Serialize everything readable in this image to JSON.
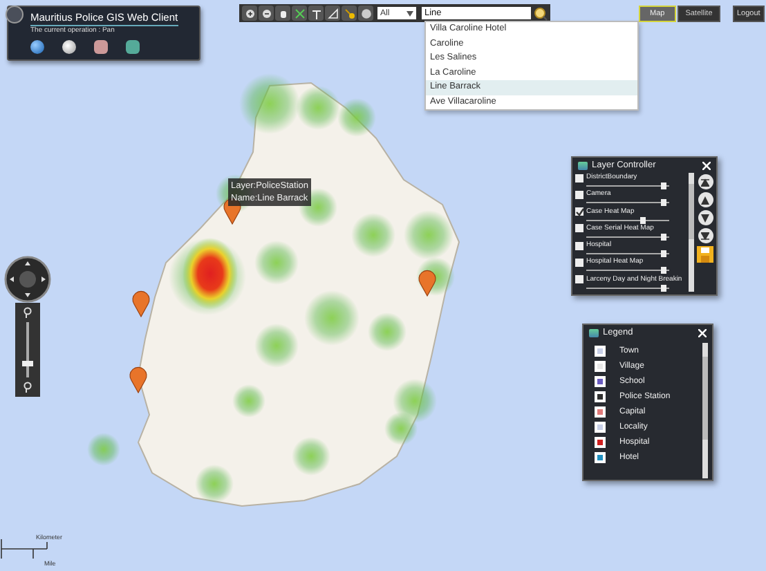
{
  "app_panel": {
    "title": "Mauritius Police GIS Web Client",
    "operation": "The current operation : Pan"
  },
  "toolbar": {
    "layer_select": "All",
    "search": {
      "value": "Line"
    },
    "suggestions": [
      {
        "label": "Villa Caroline Hotel",
        "selected": false
      },
      {
        "label": "Caroline",
        "selected": false
      },
      {
        "label": "Les Salines",
        "selected": false
      },
      {
        "label": "La Caroline",
        "selected": false
      },
      {
        "label": "Line Barrack",
        "selected": true
      },
      {
        "label": "Ave Villacaroline",
        "selected": false
      }
    ]
  },
  "map_types": [
    {
      "label": "Map",
      "selected": true
    },
    {
      "label": "Satellite",
      "selected": false
    }
  ],
  "logout": "Logout",
  "zoom_slider": {
    "level": 0.25
  },
  "map_tooltip": [
    "Layer:PoliceStation",
    "Name:Line Barrack"
  ],
  "layer_controller": {
    "title": "Layer Controller",
    "layers": [
      {
        "label": "DistrictBoundary",
        "checked": false,
        "level": 0.95
      },
      {
        "label": "Camera",
        "checked": false,
        "level": 0.95
      },
      {
        "label": "Case Heat Map",
        "checked": true,
        "level": 0.7
      },
      {
        "label": "Case Serial Heat Map",
        "checked": false,
        "level": 0.95
      },
      {
        "label": "Hospital",
        "checked": false,
        "level": 0.95
      },
      {
        "label": "Hospital Heat Map",
        "checked": false,
        "level": 0.95
      },
      {
        "label": "Larceny Day and Night Breakin",
        "checked": false,
        "level": 0.95
      }
    ]
  },
  "legend": {
    "title": "Legend",
    "items": [
      {
        "label": "Town",
        "color": "#c8d0e8"
      },
      {
        "label": "Village",
        "color": "#e8e8e8"
      },
      {
        "label": "School",
        "color": "#6a5cc0"
      },
      {
        "label": "Police Station",
        "color": "#303030"
      },
      {
        "label": "Capital",
        "color": "#e07a7a"
      },
      {
        "label": "Locality",
        "color": "#c8d0e8"
      },
      {
        "label": "Hospital",
        "color": "#d02020"
      },
      {
        "label": "Hotel",
        "color": "#2090c0"
      }
    ]
  },
  "scale": {
    "top": "Kilometer",
    "bottom": "Mile"
  }
}
